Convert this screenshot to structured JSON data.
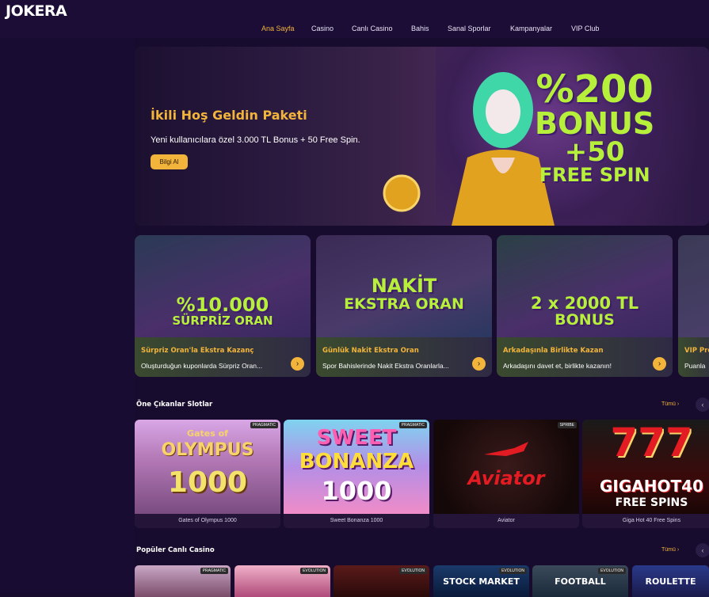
{
  "header": {
    "logo": "JOKERA",
    "nav": [
      "Ana Sayfa",
      "Casino",
      "Canlı Casino",
      "Bahis",
      "Sanal Sporlar",
      "Kampanyalar",
      "VIP Club"
    ]
  },
  "hero": {
    "title": "İkili Hoş Geldin Paketi",
    "subtitle": "Yeni kullanıcılara özel 3.000 TL Bonus + 50 Free Spin.",
    "button": "Bilgi Al",
    "art_lines": [
      "%200",
      "BONUS",
      "+50",
      "FREE SPIN"
    ]
  },
  "promos": [
    {
      "art_lines": [
        "%10.000",
        "SÜRPRİZ ORAN"
      ],
      "title": "Sürpriz Oran'la Ekstra Kazanç",
      "desc": "Oluşturduğun kuponlarda Sürpriz Oran...",
      "arrow": "›"
    },
    {
      "art_lines": [
        "NAKİT",
        "EKSTRA ORAN"
      ],
      "title": "Günlük Nakit Ekstra Oran",
      "desc": "Spor Bahislerinde Nakit Ekstra Oranlarla...",
      "arrow": "›"
    },
    {
      "art_lines": [
        "2 x 2000 TL",
        "BONUS"
      ],
      "title": "Arkadaşınla Birlikte Kazan",
      "desc": "Arkadaşını davet et, birlikte kazanın!",
      "arrow": "›"
    },
    {
      "art_lines": [],
      "title": "VIP Pro",
      "desc": "Puanla",
      "arrow": ""
    }
  ],
  "slots_section": {
    "title": "Öne Çıkanlar Slotlar",
    "more": "Tümü ›",
    "nav": "‹"
  },
  "slots": [
    {
      "name": "Gates of Olympus 1000",
      "provider": "PRAGMATIC",
      "art_lines": [
        "Gates of",
        "OLYMPUS",
        "1000"
      ]
    },
    {
      "name": "Sweet Bonanza 1000",
      "provider": "PRAGMATIC",
      "art_lines": [
        "SWEET",
        "BONANZA",
        "1000"
      ]
    },
    {
      "name": "Aviator",
      "provider": "SPRIBE",
      "art_lines": [
        "Aviator"
      ]
    },
    {
      "name": "Giga Hot 40 Free Spins",
      "provider": "",
      "art_lines": [
        "777",
        "GIGAHOT40",
        "FREE SPINS"
      ]
    }
  ],
  "live_section": {
    "title": "Popüler Canlı Casino",
    "more": "Tümü ›",
    "nav": "‹"
  },
  "live": [
    {
      "provider": "PRAGMATIC",
      "art": ""
    },
    {
      "provider": "EVOLUTION",
      "art": ""
    },
    {
      "provider": "EVOLUTION",
      "art": ""
    },
    {
      "provider": "EVOLUTION",
      "art": "STOCK MARKET"
    },
    {
      "provider": "EVOLUTION",
      "art": "FOOTBALL"
    },
    {
      "provider": "",
      "art": "ROULETTE"
    }
  ]
}
